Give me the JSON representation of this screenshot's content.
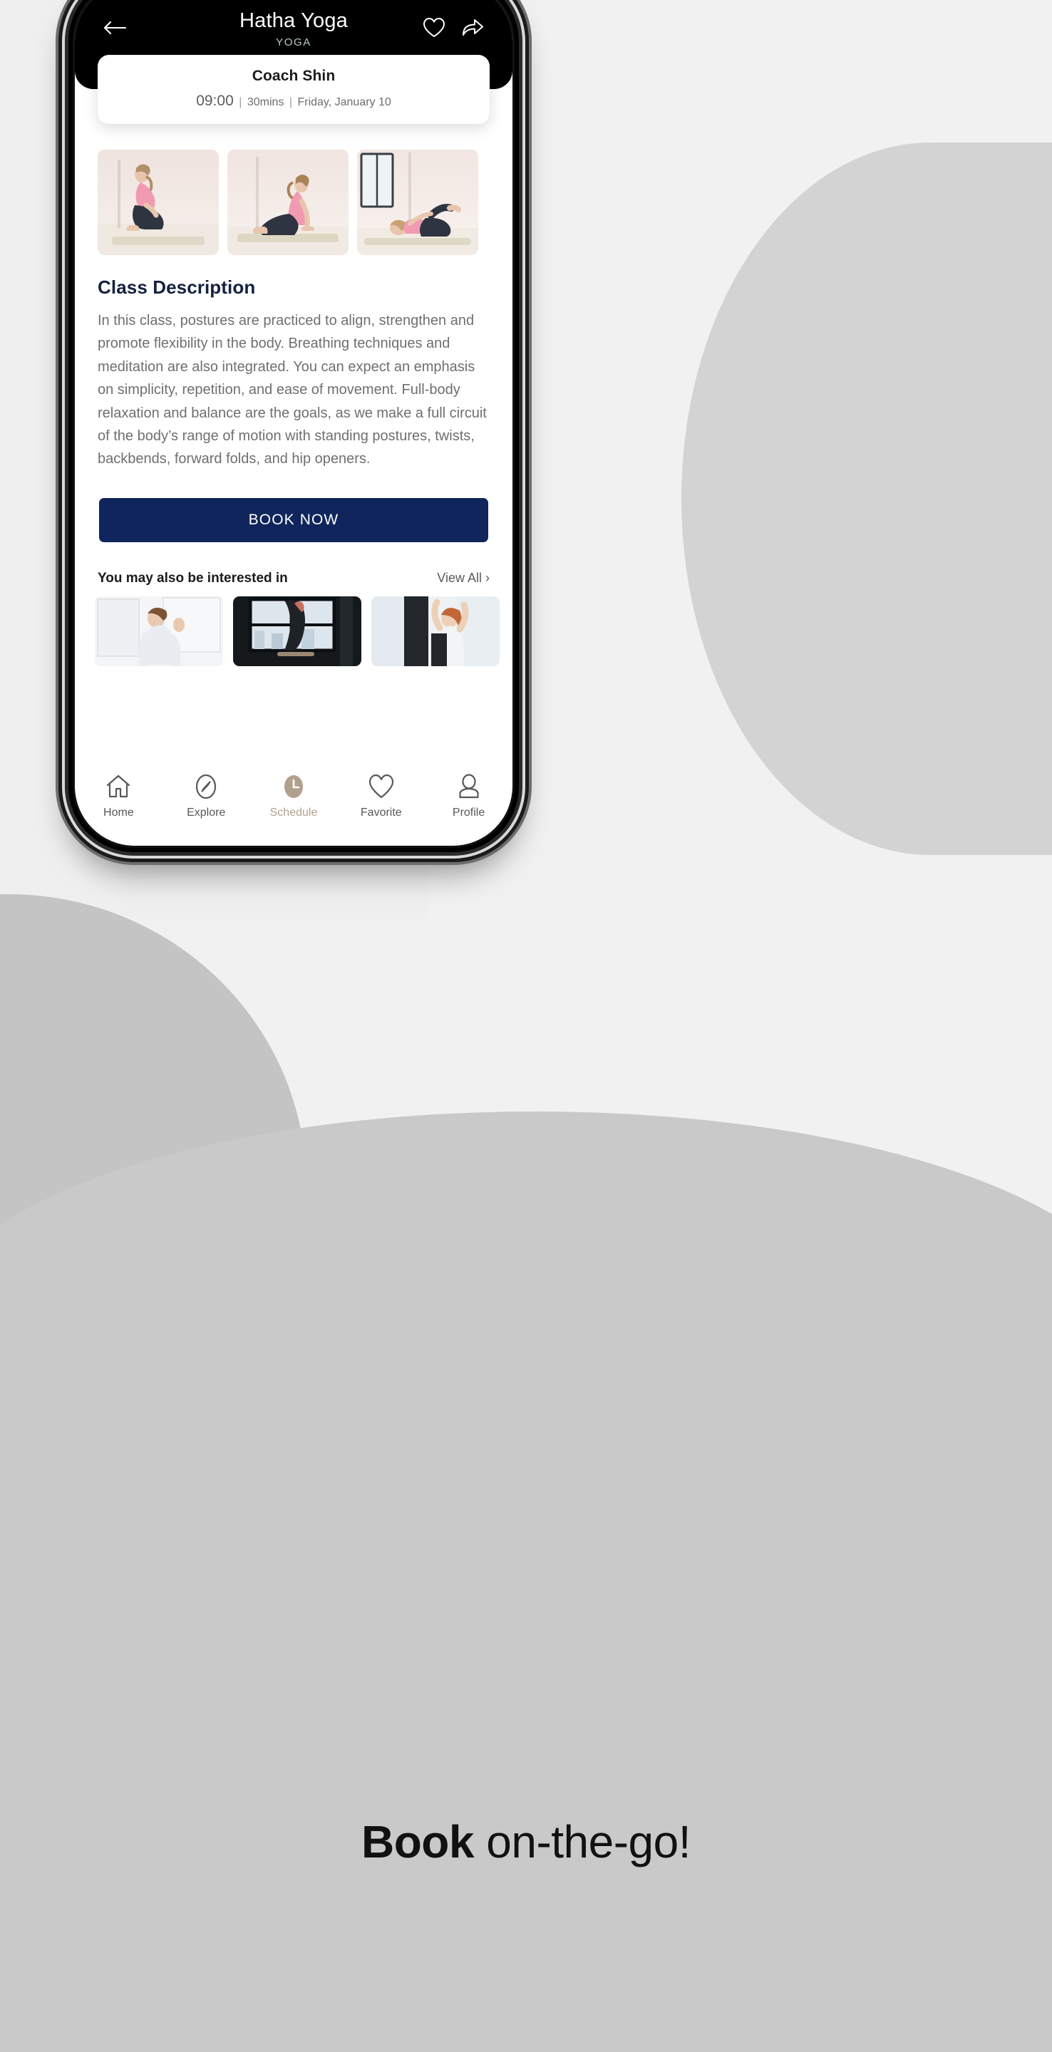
{
  "header": {
    "title": "Hatha Yoga",
    "subtitle": "YOGA",
    "back_icon": "arrow-left-icon",
    "favorite_icon": "heart-outline-icon",
    "share_icon": "share-arrow-icon"
  },
  "coach_card": {
    "name": "Coach Shin",
    "time": "09:00",
    "duration": "30mins",
    "date": "Friday, January 10",
    "separator": "|"
  },
  "gallery": {
    "items": [
      {
        "alt": "yoga-pose-kneeling-backbend"
      },
      {
        "alt": "yoga-pose-cobra"
      },
      {
        "alt": "yoga-pose-supine-knee-hug"
      }
    ]
  },
  "description": {
    "title": "Class Description",
    "body": "In this class, postures are practiced to align, strengthen and promote flexibility in the body. Breathing techniques and meditation are also integrated. You can expect an emphasis on simplicity, repetition, and ease of movement. Full-body relaxation and balance are the goals, as we make a full circuit of the body’s range of motion with standing postures, twists, backbends, forward folds, and hip openers."
  },
  "book": {
    "label": "BOOK NOW",
    "color": "#10255c"
  },
  "related": {
    "title": "You may also be interested in",
    "view_all": "View All",
    "chevron": "›",
    "items": [
      {
        "alt": "class-thumb-partner-stretch"
      },
      {
        "alt": "class-thumb-studio-barre"
      },
      {
        "alt": "class-thumb-arms-overhead"
      }
    ]
  },
  "tabbar": {
    "items": [
      {
        "label": "Home",
        "icon": "home-icon",
        "active": false
      },
      {
        "label": "Explore",
        "icon": "compass-icon",
        "active": false
      },
      {
        "label": "Schedule",
        "icon": "clock-icon",
        "active": true
      },
      {
        "label": "Favorite",
        "icon": "heart-icon",
        "active": false
      },
      {
        "label": "Profile",
        "icon": "person-icon",
        "active": false
      }
    ],
    "active_color": "#b2a08f"
  },
  "tagline": {
    "bold": "Book",
    "rest": " on-the-go!"
  }
}
